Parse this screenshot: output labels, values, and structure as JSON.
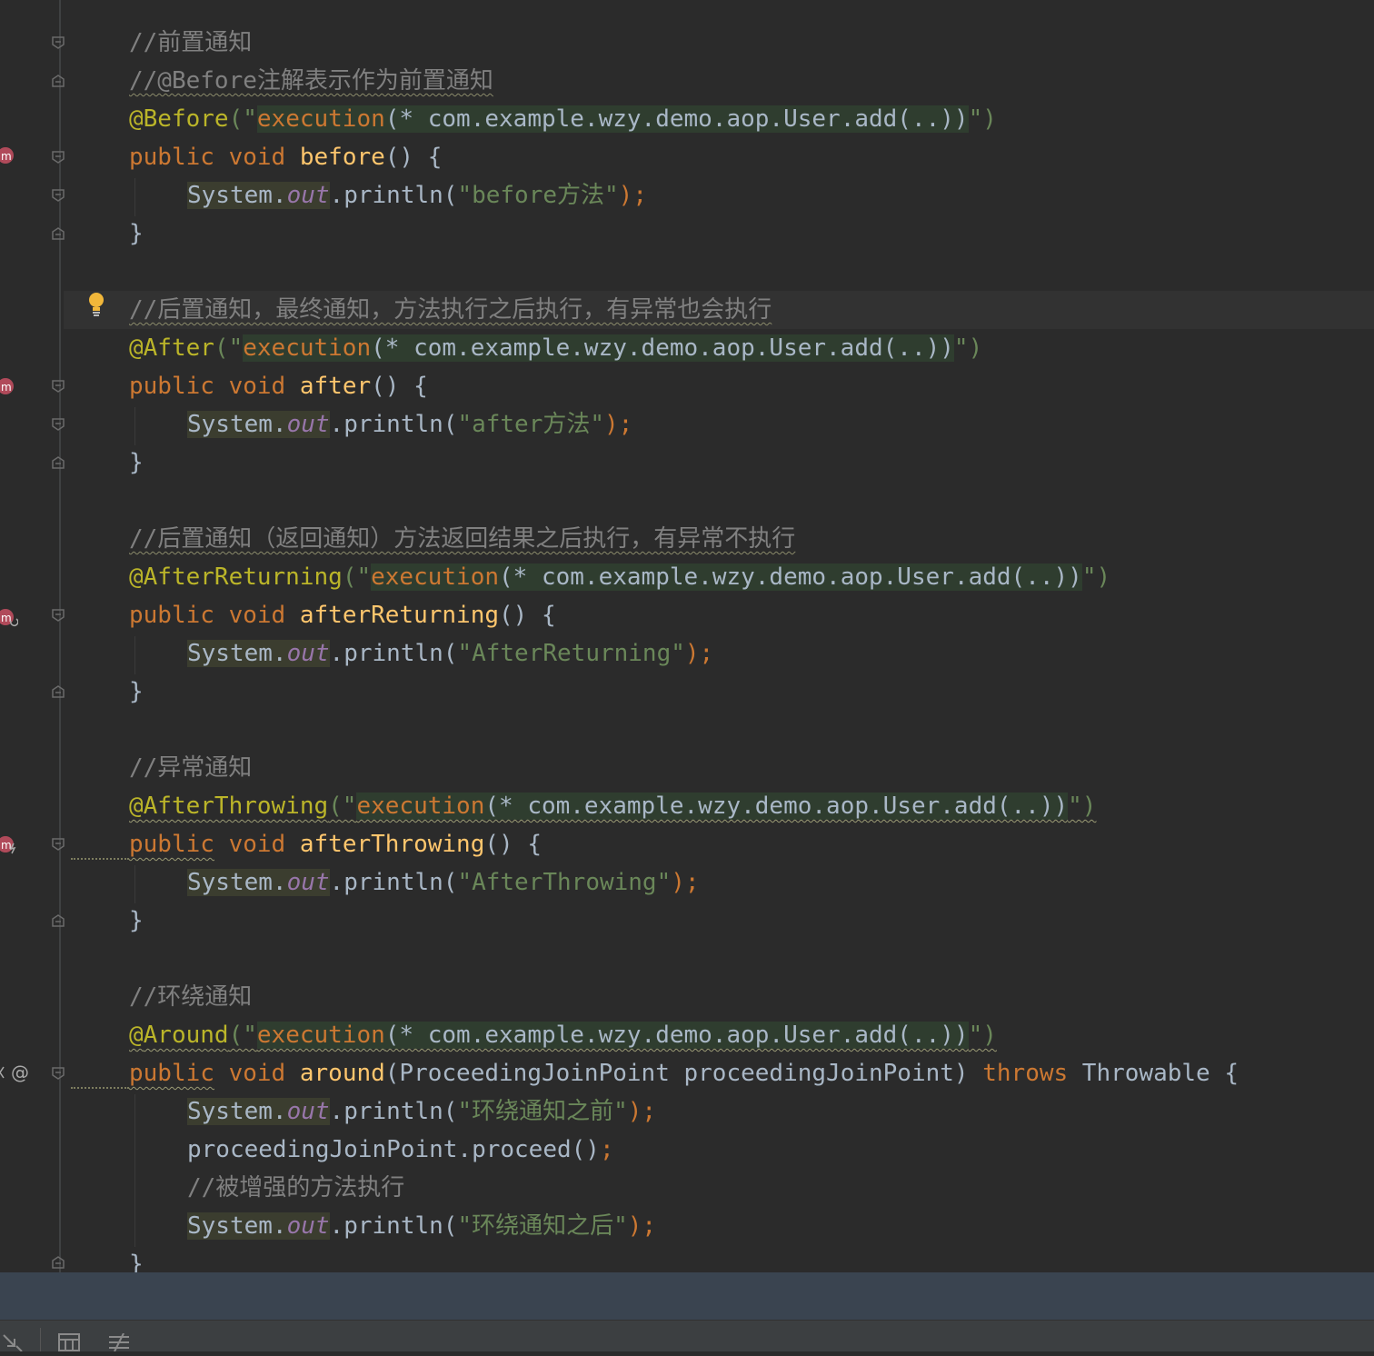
{
  "lines": {
    "c1": "//前置通知",
    "c2": "//@Before注解表示作为前置通知",
    "b_ann": "@Before",
    "b_str_open": "(\"",
    "b_exec": "execution",
    "b_expr": "(* com.example.wzy.demo.aop.User.add(..))",
    "b_close": "\")",
    "pub": "public",
    "void": "void",
    "b_name": "before",
    "parens_brace": "() {",
    "sys": "System.",
    "out": "out",
    "println": ".println(",
    "b_msg": "\"before方法\"",
    "endstmt": ");",
    "rbrace": "}",
    "c3": "//后置通知，最终通知，方法执行之后执行，有异常也会执行",
    "a_ann": "@After",
    "a_name": "after",
    "a_msg": "\"after方法\"",
    "c4": "//后置通知（返回通知）方法返回结果之后执行，有异常不执行",
    "ar_ann": "@AfterReturning",
    "ar_name": "afterReturning",
    "ar_msg": "\"AfterReturning\"",
    "c5": "//异常通知",
    "at_ann": "@AfterThrowing",
    "at_name": "afterThrowing",
    "at_msg": "\"AfterThrowing\"",
    "c6": "//环绕通知",
    "ro_at": "@",
    "ro_ann": "Around",
    "ro_name": "around",
    "ro_params": "(ProceedingJoinPoint proceedingJoinPoint) ",
    "throws": "throws",
    "throwable": " Throwable {",
    "ro_msg1": "\"环绕通知之前\"",
    "proceed": "proceedingJoinPoint.proceed()",
    "semi": ";",
    "c7": "//被增强的方法执行",
    "ro_msg2": "\"环绕通知之后\""
  },
  "gutter": {
    "at_symbol": "@"
  },
  "icons": [
    "fold-marker-icon",
    "advice-method-icon",
    "lightbulb-icon",
    "at-annotation-icon",
    "toolbar-icons"
  ],
  "colors": {
    "background": "#2b2b2b",
    "keyword": "#cc7832",
    "annotation": "#bbb529",
    "method": "#ffc66d",
    "string": "#6a8759",
    "comment": "#808080",
    "field": "#9876aa",
    "text": "#a9b7c6",
    "status_bar": "#3a4450"
  }
}
